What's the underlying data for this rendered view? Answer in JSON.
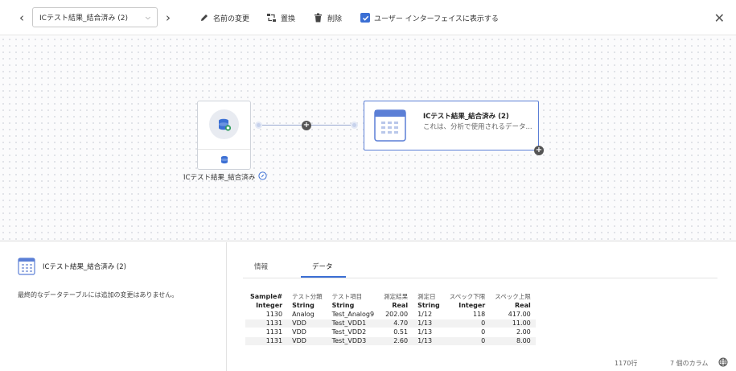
{
  "toolbar": {
    "prev_label": "‹",
    "next_label": "›",
    "dataset_select": "ICテスト結果_結合済み (2)",
    "rename_label": "名前の変更",
    "replace_label": "置換",
    "delete_label": "削除",
    "show_in_ui_label": "ユーザー インターフェイスに表示する",
    "show_in_ui_checked": true,
    "close_label": "✕"
  },
  "canvas": {
    "source_node_label": "ICテスト結果_結合済み",
    "table_node": {
      "title": "ICテスト結果_結合済み (2)",
      "description": "これは、分析で使用されるデータ..."
    },
    "plus_symbol": "+"
  },
  "details": {
    "title": "ICテスト結果_結合済み (2)",
    "message": "最終的なデータテーブルには追加の変更はありません。"
  },
  "tabs": [
    {
      "label": "情報",
      "active": false
    },
    {
      "label": "データ",
      "active": true
    }
  ],
  "table": {
    "columns": [
      {
        "name": "Sample#",
        "type": "Integer",
        "align": "num",
        "jp": false
      },
      {
        "name": "テスト分類",
        "type": "String",
        "align": "txt",
        "jp": true
      },
      {
        "name": "テスト項目",
        "type": "String",
        "align": "txt",
        "jp": true
      },
      {
        "name": "測定結果",
        "type": "Real",
        "align": "num",
        "jp": true
      },
      {
        "name": "測定日",
        "type": "String",
        "align": "txt",
        "jp": true
      },
      {
        "name": "スペック下限",
        "type": "Integer",
        "align": "num",
        "jp": true
      },
      {
        "name": "スペック上限",
        "type": "Real",
        "align": "num",
        "jp": true
      }
    ],
    "rows": [
      [
        "1130",
        "Analog",
        "Test_Analog9",
        "202.00",
        "1/12",
        "118",
        "417.00"
      ],
      [
        "1131",
        "VDD",
        "Test_VDD1",
        "4.70",
        "1/13",
        "0",
        "11.00"
      ],
      [
        "1131",
        "VDD",
        "Test_VDD2",
        "0.51",
        "1/13",
        "0",
        "2.00"
      ],
      [
        "1131",
        "VDD",
        "Test_VDD3",
        "2.60",
        "1/13",
        "0",
        "8.00"
      ]
    ],
    "row_count": "1170行",
    "col_count": "7 個のカラム"
  },
  "colors": {
    "accent": "#3b6fd4",
    "node_border_selected": "#5b7fd6"
  },
  "icons": [
    "chevron-left-icon",
    "chevron-right-icon",
    "chevron-down-icon",
    "pencil-icon",
    "replace-icon",
    "trash-icon",
    "checkbox-icon",
    "close-icon",
    "database-icon",
    "table-icon",
    "compass-icon",
    "globe-icon",
    "plus-icon"
  ]
}
